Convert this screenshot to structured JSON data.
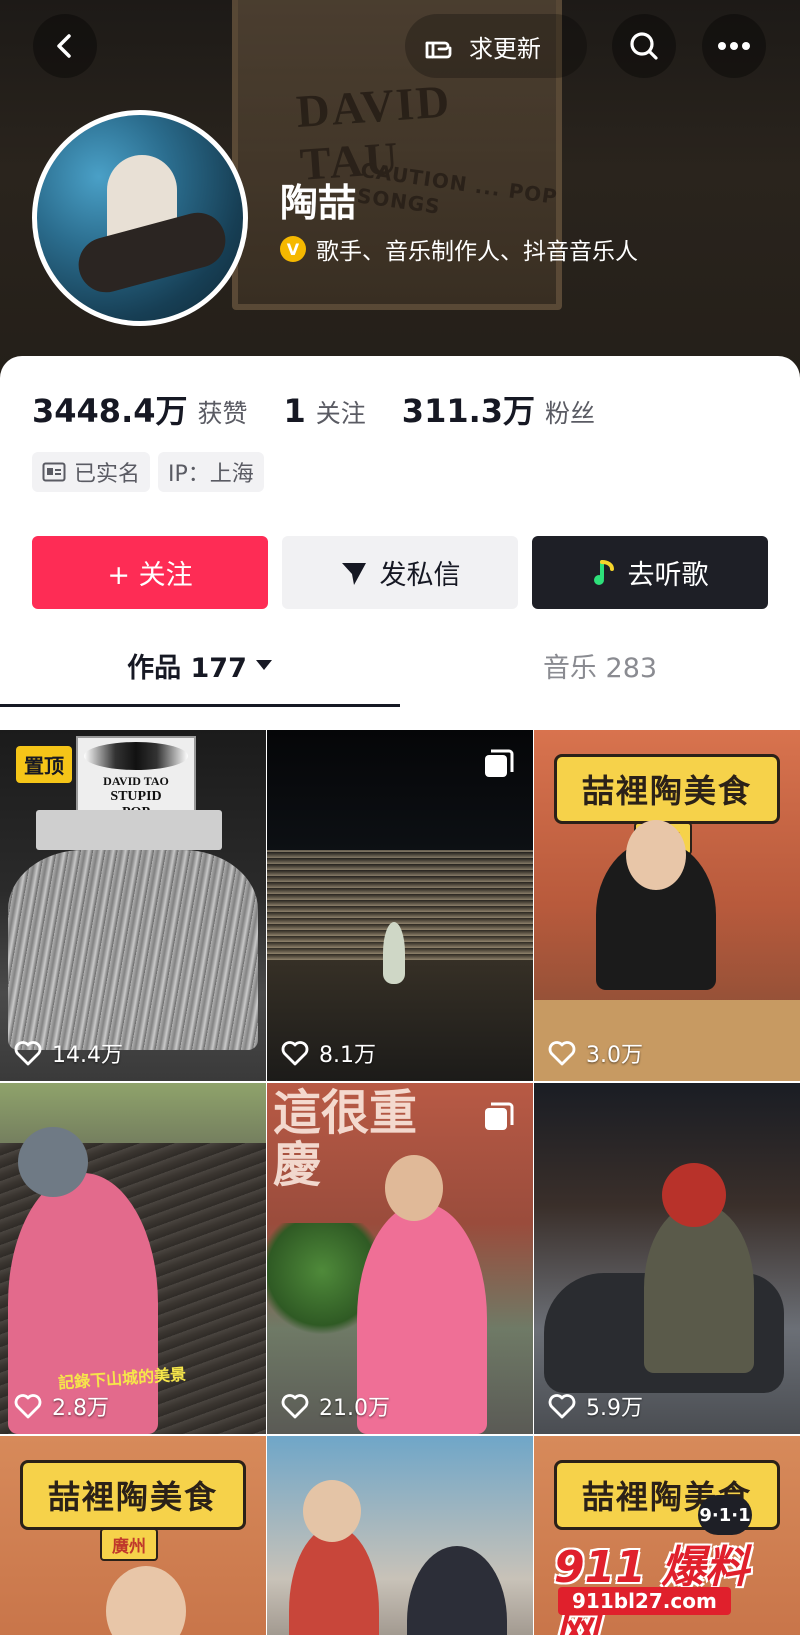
{
  "header": {
    "request_update_label": "求更新",
    "crate_brand": "DAVID TAU",
    "crate_text": "CAUTION ... POP SONGS"
  },
  "profile": {
    "name": "陶喆",
    "titles": "歌手、音乐制作人、抖音音乐人",
    "verify_badge": "V"
  },
  "stats": {
    "likes_num": "3448.4万",
    "likes_label": "获赞",
    "following_num": "1",
    "following_label": "关注",
    "fans_num": "311.3万",
    "fans_label": "粉丝"
  },
  "tags": {
    "verified": "已实名",
    "ip": "IP：上海"
  },
  "actions": {
    "follow": "+ 关注",
    "message": "发私信",
    "listen": "去听歌"
  },
  "tabs": {
    "works_label": "作品 177",
    "music_label": "音乐 283"
  },
  "videos": [
    {
      "likes": "14.4万",
      "badge": "置顶",
      "poster_line1": "DAVID TAO",
      "poster_line2": "STUPID",
      "poster_line3": "POP"
    },
    {
      "likes": "8.1万"
    },
    {
      "likes": "3.0万",
      "banner": "喆裡陶美食",
      "sub": "重慶"
    },
    {
      "likes": "2.8万",
      "caption": "記錄下山城的美景"
    },
    {
      "likes": "21.0万",
      "wall_text": "這很重慶"
    },
    {
      "likes": "5.9万"
    },
    {
      "banner": "喆裡陶美食",
      "sub": "廣州"
    },
    {},
    {
      "banner": "喆裡陶美食"
    }
  ],
  "watermark": {
    "badge": "9·1·1",
    "text": "911 爆料网",
    "url": "911bl27.com"
  }
}
